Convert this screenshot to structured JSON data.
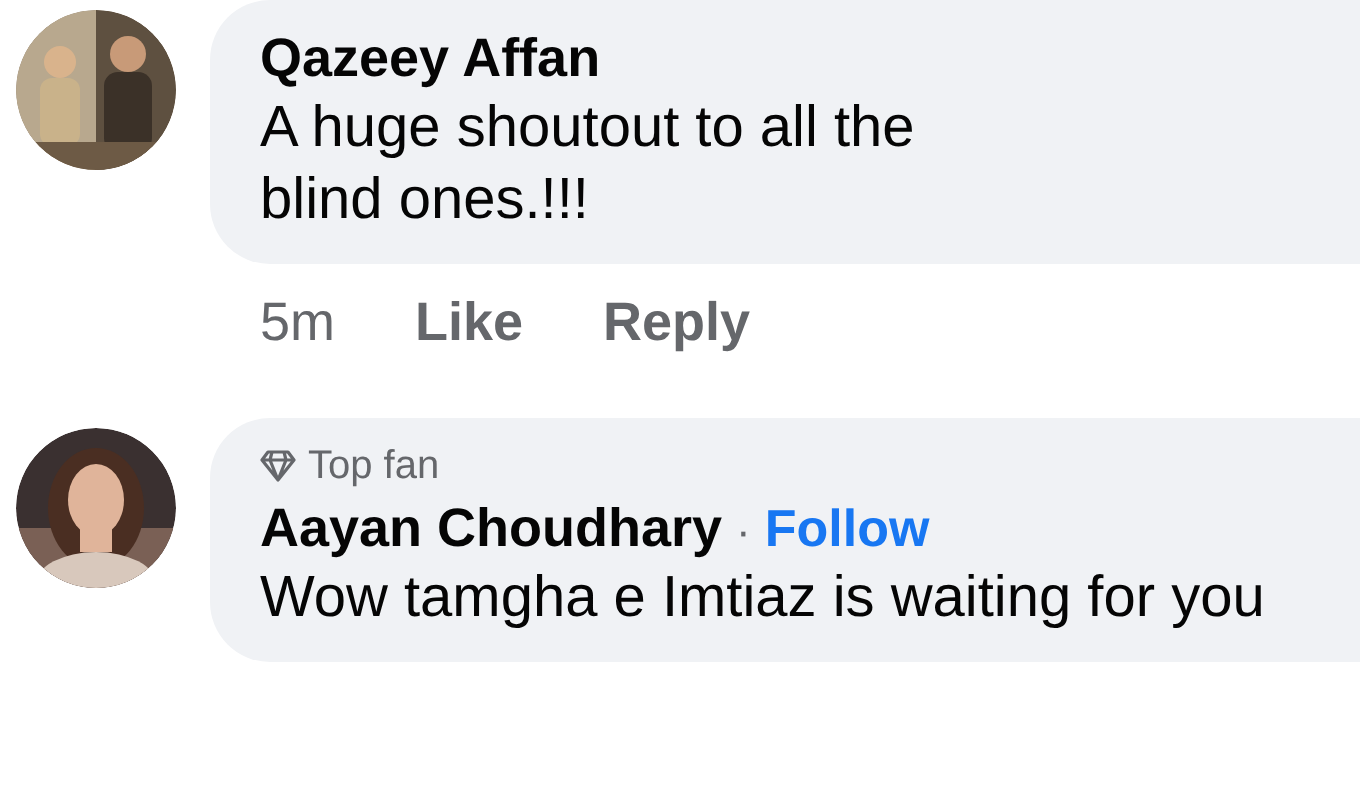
{
  "comments": [
    {
      "author": "Qazeey Affan",
      "text": "A huge shoutout to all the blind ones.!!!",
      "time": "5m",
      "actions": [
        "Like",
        "Reply"
      ]
    },
    {
      "badge": "Top fan",
      "author": "Aayan Choudhary",
      "separator": "·",
      "follow": "Follow",
      "text": "Wow tamgha e Imtiaz is waiting for you"
    }
  ]
}
